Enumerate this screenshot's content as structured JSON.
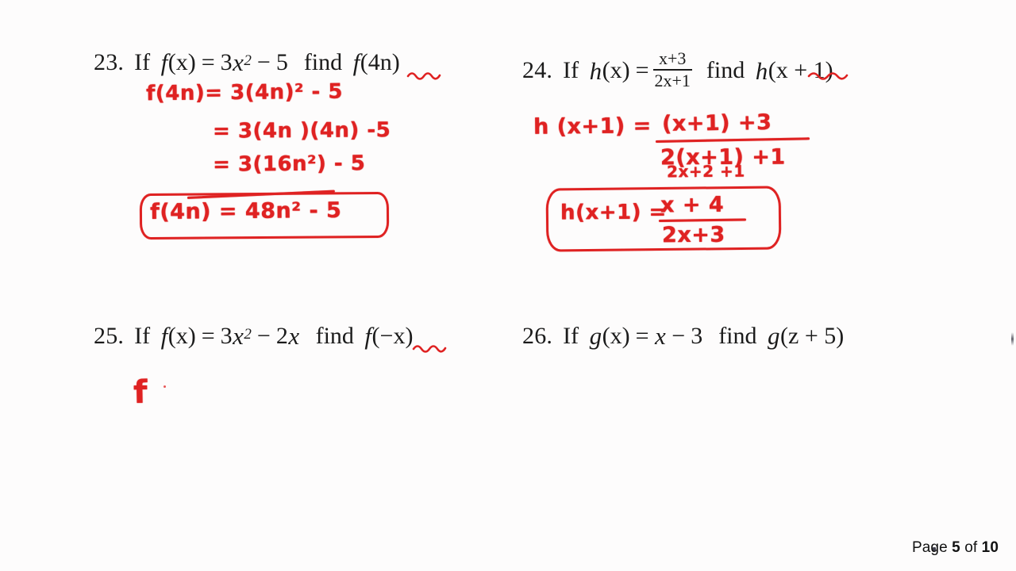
{
  "document": {
    "type": "math-worksheet-video-frame",
    "background_color": "#fdfcfc",
    "ink_color": "#df2222",
    "text_color": "#1b1b1b"
  },
  "problems": [
    {
      "id": "23",
      "number": "23.",
      "if_word": "If",
      "find_word": "find",
      "function_def": {
        "name": "f",
        "arg": "(x)",
        "equals": "=",
        "rule_coef": "3",
        "rule_var": "x",
        "rule_exp": "2",
        "rule_op": "−",
        "rule_const": "5"
      },
      "question": {
        "name": "f",
        "arg": "(4n)",
        "arg_inner": "4n"
      },
      "underline": "4n",
      "work": [
        {
          "line": "f(4n)= 3(4n)² - 5"
        },
        {
          "line": "= 3(4n )(4n) -5"
        },
        {
          "line": "= 3(16n²) - 5"
        }
      ],
      "answer": "f(4n) = 48n² - 5",
      "answer_boxed": true
    },
    {
      "id": "24",
      "number": "24.",
      "if_word": "If",
      "find_word": "find",
      "function_def": {
        "name": "h",
        "arg": "(x)",
        "equals": "=",
        "numerator": "x+3",
        "denominator": "2x+1"
      },
      "question": {
        "name": "h",
        "arg": "(x + 1)",
        "arg_inner": "x + 1"
      },
      "underline": "x +",
      "work": {
        "lhs": "h (x+1) =",
        "numerator": "(x+1)  +3",
        "denominator": "2(x+1) +1",
        "denominator_expanded": "2x+2 +1"
      },
      "answer": {
        "lhs": "h(x+1) =",
        "numerator": "x + 4",
        "denominator": "2x+3"
      },
      "answer_boxed": true
    },
    {
      "id": "25",
      "number": "25.",
      "if_word": "If",
      "find_word": "find",
      "function_def": {
        "name": "f",
        "arg": "(x)",
        "equals": "=",
        "rule_coef": "3",
        "rule_var": "x",
        "rule_exp": "2",
        "rule_op": "−",
        "rule_term2_coef": "2",
        "rule_term2_var": "x"
      },
      "question": {
        "name": "f",
        "arg": "(−x)",
        "arg_inner": "−x"
      },
      "underline": "−x",
      "work": [
        {
          "line": "f"
        }
      ],
      "answer": "",
      "answer_boxed": false
    },
    {
      "id": "26",
      "number": "26.",
      "if_word": "If",
      "find_word": "find",
      "function_def": {
        "name": "g",
        "arg": "(x)",
        "equals": "=",
        "rule_var": "x",
        "rule_op": "−",
        "rule_const": "3"
      },
      "question": {
        "name": "g",
        "arg": "(z + 5)",
        "arg_inner": "z + 5"
      },
      "underline": "",
      "work": [],
      "answer": "",
      "answer_boxed": false
    }
  ],
  "footer": {
    "prefix": "Page",
    "current_page": "5",
    "middle": "of",
    "total_pages": "10"
  }
}
